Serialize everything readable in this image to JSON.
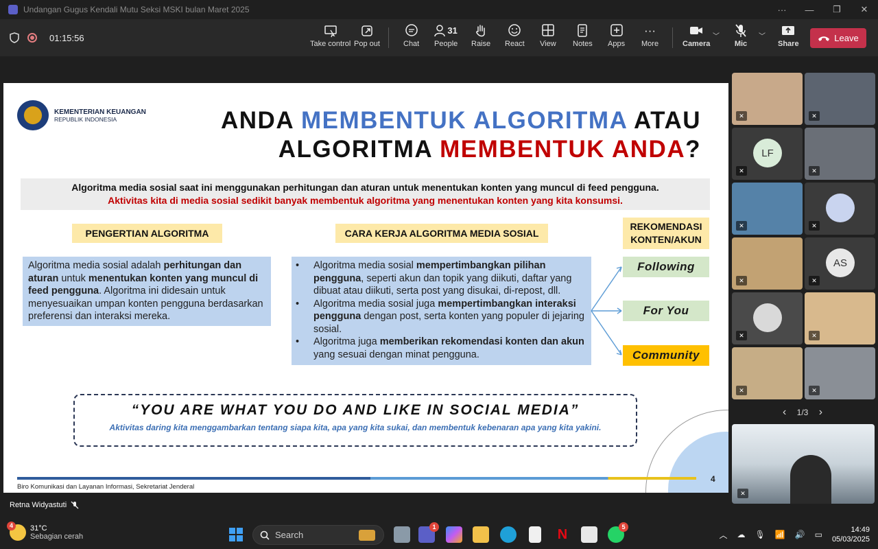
{
  "window": {
    "title": "Undangan Gugus Kendali Mutu Seksi MSKI bulan Maret 2025",
    "more": "···",
    "minimize": "—",
    "maximize": "❐",
    "close": "✕"
  },
  "meeting": {
    "timer": "01:15:56"
  },
  "toolbar": {
    "take_control": "Take control",
    "pop_out": "Pop out",
    "chat": "Chat",
    "people": "People",
    "people_count": "31",
    "raise": "Raise",
    "react": "React",
    "view": "View",
    "notes": "Notes",
    "apps": "Apps",
    "more": "More",
    "camera": "Camera",
    "mic": "Mic",
    "share": "Share",
    "leave": "Leave"
  },
  "slide": {
    "org_name": "KEMENTERIAN KEUANGAN",
    "org_sub": "REPUBLIK INDONESIA",
    "headline": {
      "p1": "ANDA ",
      "p2": "MEMBENTUK ALGORITMA",
      "p3": " ATAU",
      "p4": "ALGORITMA ",
      "p5": "MEMBENTUK ANDA",
      "p6": "?"
    },
    "intro_line1": "Algoritma media sosial saat ini menggunakan perhitungan dan aturan untuk menentukan konten yang muncul di feed pengguna.",
    "intro_line2": "Aktivitas kita di media sosial sedikit banyak membentuk algoritma yang menentukan konten yang kita konsumsi.",
    "col1_title": "PENGERTIAN ALGORITMA",
    "col1_text": {
      "a": "Algoritma media sosial adalah ",
      "b": "perhitungan dan aturan",
      "c": " untuk ",
      "d": "menentukan konten yang muncul di feed pengguna",
      "e": ". Algoritma ini didesain untuk menyesuaikan umpan konten pengguna berdasarkan preferensi dan interaksi mereka."
    },
    "col2_title": "CARA KERJA ALGORITMA MEDIA SOSIAL",
    "col2_items": [
      {
        "a": "Algoritma media sosial ",
        "b": "mempertimbangkan pilihan pengguna",
        "c": ", seperti akun dan topik yang diikuti, daftar yang dibuat atau diikuti, serta post yang disukai, di-repost, dll."
      },
      {
        "a": "Algoritma media sosial juga ",
        "b": "mempertimbangkan interaksi pengguna",
        "c": " dengan post, serta konten yang populer di jejaring sosial."
      },
      {
        "a": "Algoritma juga ",
        "b": "memberikan rekomendasi konten dan akun",
        "c": " yang sesuai dengan minat pengguna."
      }
    ],
    "col3_title_l1": "REKOMENDASI",
    "col3_title_l2": "KONTEN/AKUN",
    "rec": [
      "Following",
      "For You",
      "Community"
    ],
    "quote": "“YOU ARE WHAT YOU DO AND LIKE IN SOCIAL MEDIA”",
    "quote_sub": "Aktivitas daring kita menggambarkan tentang siapa kita, apa yang kita sukai, dan membentuk kebenaran apa yang kita yakini.",
    "footer": "Biro Komunikasi dan Layanan Informasi, Sekretariat Jenderal",
    "page_number": "4"
  },
  "speaker": {
    "name": "Retna Widyastuti"
  },
  "participants": [
    {
      "initials": "",
      "bg": "#c8a98a"
    },
    {
      "initials": "",
      "bg": "#5c6470"
    },
    {
      "initials": "LF",
      "bg": "#3b3b3b",
      "avatar": "#d9ecd9"
    },
    {
      "initials": "",
      "bg": "#6a6f77"
    },
    {
      "initials": "",
      "bg": "#5582a8"
    },
    {
      "initials": "",
      "bg": "#3b3b3b",
      "avatar": "#c9d4ef"
    },
    {
      "initials": "",
      "bg": "#c2a273"
    },
    {
      "initials": "AS",
      "bg": "#3b3b3b",
      "avatar": "#e8e8e8"
    },
    {
      "initials": "",
      "bg": "#4a4a4a",
      "avatar": "#d9d9d9"
    },
    {
      "initials": "",
      "bg": "#d8b98d"
    },
    {
      "initials": "",
      "bg": "#c6ad86"
    },
    {
      "initials": "",
      "bg": "#8a8f96"
    }
  ],
  "pager": {
    "label": "1/3",
    "prev": "‹",
    "next": "›"
  },
  "taskbar": {
    "weather_temp": "31°C",
    "weather_desc": "Sebagian cerah",
    "weather_badge": "4",
    "search_placeholder": "Search",
    "teams_badge": "1",
    "whatsapp_badge": "5",
    "time": "14:49",
    "date": "05/03/2025"
  }
}
